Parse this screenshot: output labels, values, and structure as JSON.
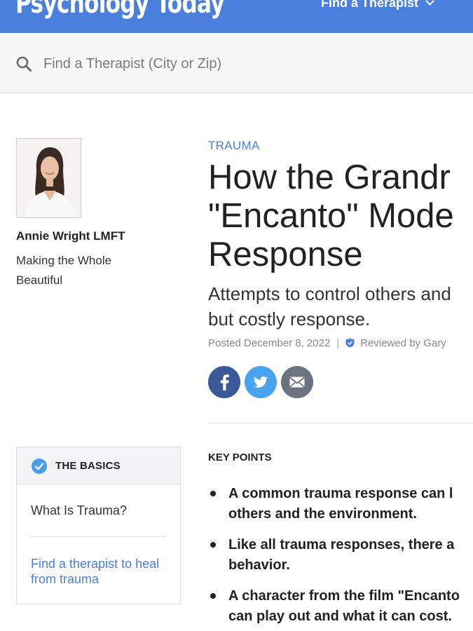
{
  "header": {
    "logo_text": "Psychology Today",
    "nav_find_label": "Find a Therapist"
  },
  "search": {
    "placeholder": "Find a Therapist (City or Zip)"
  },
  "author": {
    "name": "Annie Wright LMFT",
    "tagline": "Making the Whole Beautiful"
  },
  "article": {
    "category": "TRAUMA",
    "headline_lines": [
      "How the Grandr",
      "\"Encanto\" Mode",
      "Response"
    ],
    "subhead_lines": [
      "Attempts to control others and",
      "but costly response."
    ],
    "posted": "Posted December 8, 2022",
    "reviewed": "Reviewed by Gary"
  },
  "share": {
    "icons": [
      "facebook-icon",
      "twitter-icon",
      "email-icon"
    ],
    "colors": {
      "facebook": "#3b5998",
      "twitter": "#4aa3ee",
      "email": "#6b7380"
    }
  },
  "basics": {
    "title": "THE BASICS",
    "item": "What Is Trauma?",
    "link": "Find a therapist to heal from trauma"
  },
  "key_points": {
    "title": "KEY POINTS",
    "items": [
      [
        "A common trauma response can l",
        "others and the environment."
      ],
      [
        "Like all trauma responses, there a",
        "behavior."
      ],
      [
        "A character from the film \"Encanto",
        "can play out and what it can cost."
      ]
    ]
  },
  "colors": {
    "brand_blue": "#4a7fdc",
    "text": "#222222"
  }
}
